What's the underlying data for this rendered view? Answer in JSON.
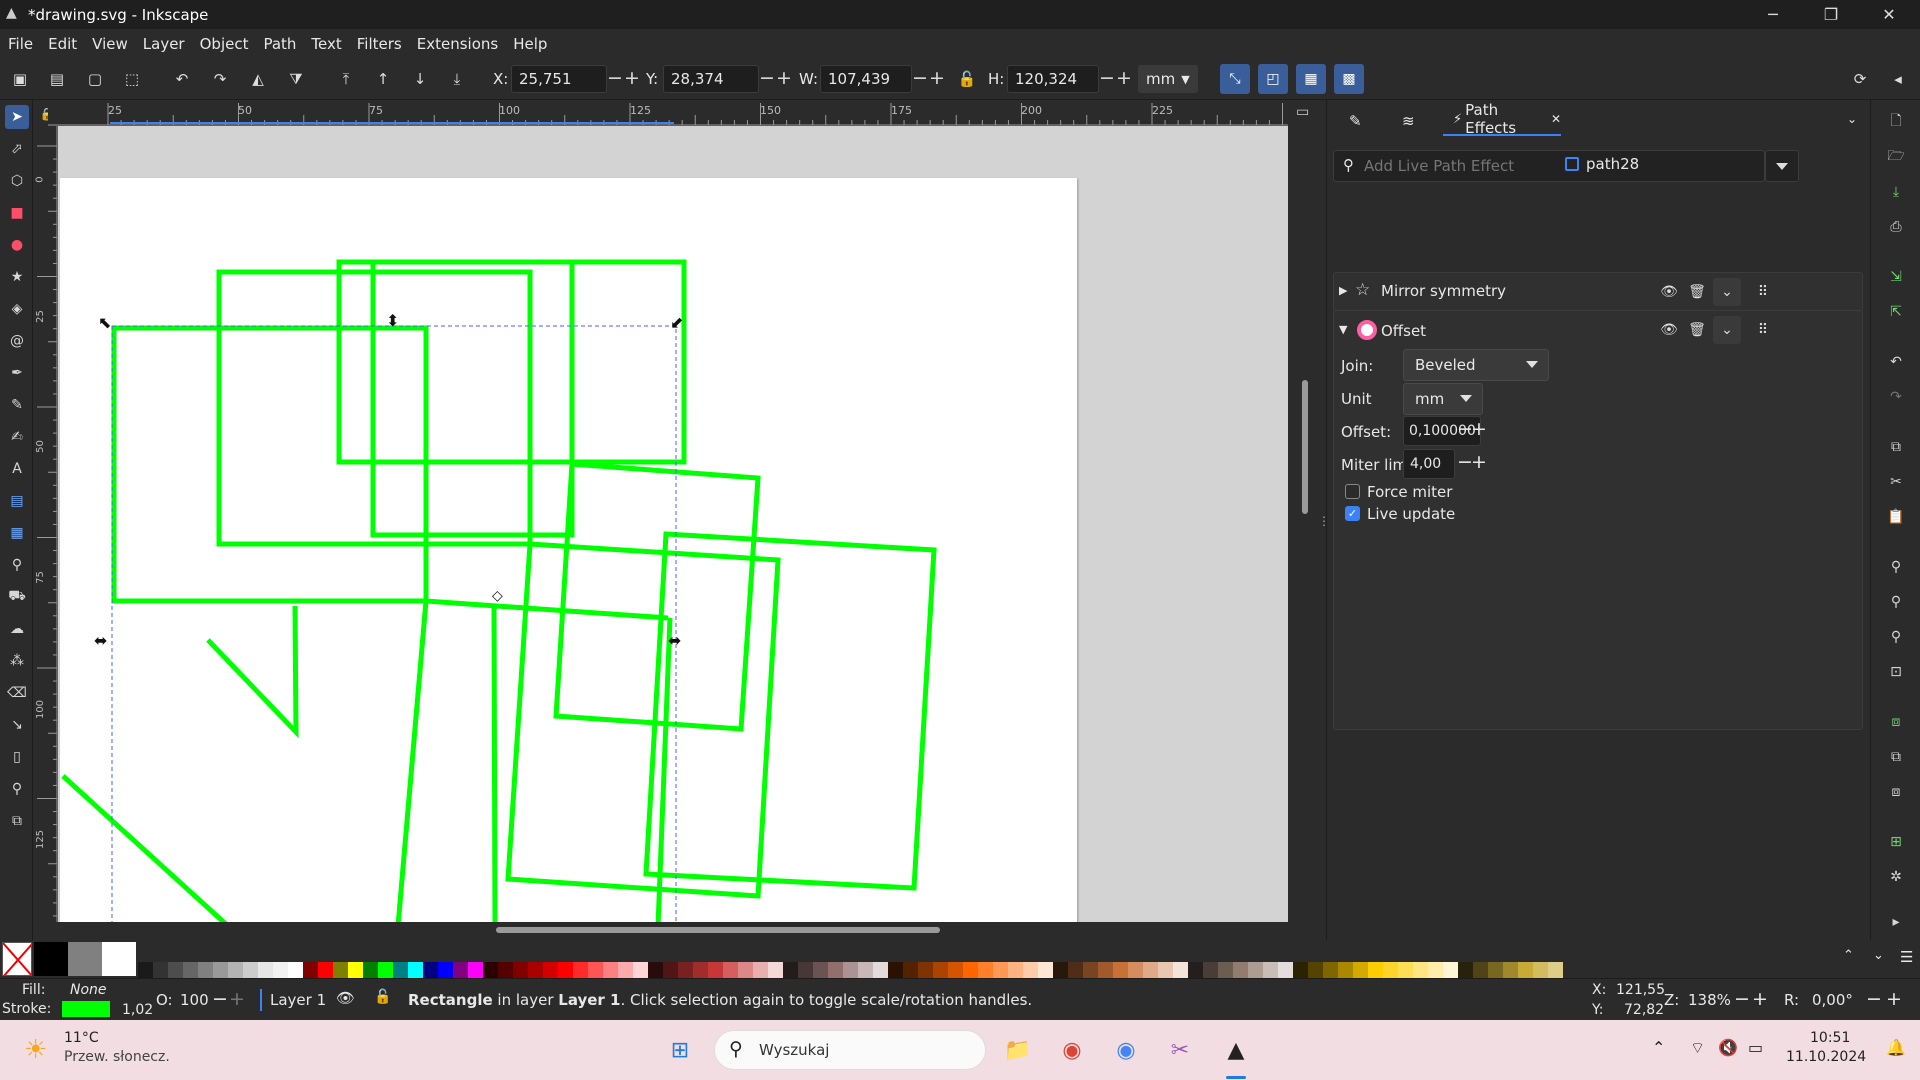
{
  "window": {
    "title": "*drawing.svg - Inkscape"
  },
  "menu": [
    "File",
    "Edit",
    "View",
    "Layer",
    "Object",
    "Path",
    "Text",
    "Filters",
    "Extensions",
    "Help"
  ],
  "toolbar": {
    "x_label": "X:",
    "x_value": "25,751",
    "y_label": "Y:",
    "y_value": "28,374",
    "w_label": "W:",
    "w_value": "107,439",
    "h_label": "H:",
    "h_value": "120,324",
    "unit": "mm"
  },
  "ruler_top": [
    "25",
    "50",
    "75",
    "100",
    "125",
    "150",
    "175",
    "200",
    "225"
  ],
  "ruler_left": [
    "0",
    "25",
    "50",
    "75",
    "100",
    "125"
  ],
  "panel": {
    "tab_label": "Path Effects",
    "search_placeholder": "Add Live Path Effect",
    "object_name": "path28",
    "effects": [
      {
        "name": "Mirror symmetry",
        "expanded": false
      },
      {
        "name": "Offset",
        "expanded": true
      }
    ],
    "params": {
      "join_label": "Join:",
      "join_value": "Beveled",
      "unit_label": "Unit",
      "unit_value": "mm",
      "offset_label": "Offset:",
      "offset_value": "0,100000",
      "miter_label": "Miter limit:",
      "miter_value": "4,00",
      "force_miter_label": "Force miter",
      "force_miter_checked": false,
      "live_update_label": "Live update",
      "live_update_checked": true
    }
  },
  "status": {
    "fill_label": "Fill:",
    "fill_value": "None",
    "stroke_label": "Stroke:",
    "stroke_width": "1,02",
    "stroke_color": "#00ff00",
    "opacity_label": "O:",
    "opacity_value": "100",
    "layer_name": "Layer 1",
    "message_bold": "Rectangle",
    "message_mid": " in layer ",
    "message_layer": "Layer 1",
    "message_rest": ". Click selection again to toggle scale/rotation handles.",
    "cursor_x_label": "X:",
    "cursor_x": "121,55",
    "cursor_y_label": "Y:",
    "cursor_y": "72,82",
    "zoom_label": "Z:",
    "zoom_value": "138%",
    "rotate_label": "R:",
    "rotate_value": "0,00°"
  },
  "taskbar": {
    "weather_temp": "11°C",
    "weather_desc": "Przew. słonecz.",
    "search_placeholder": "Wyszukaj",
    "time": "10:51",
    "date": "11.10.2024"
  },
  "colors": {
    "accent": "#3b82f6",
    "stroke_green": "#00ff00",
    "selection_blue": "#4a62ff"
  }
}
